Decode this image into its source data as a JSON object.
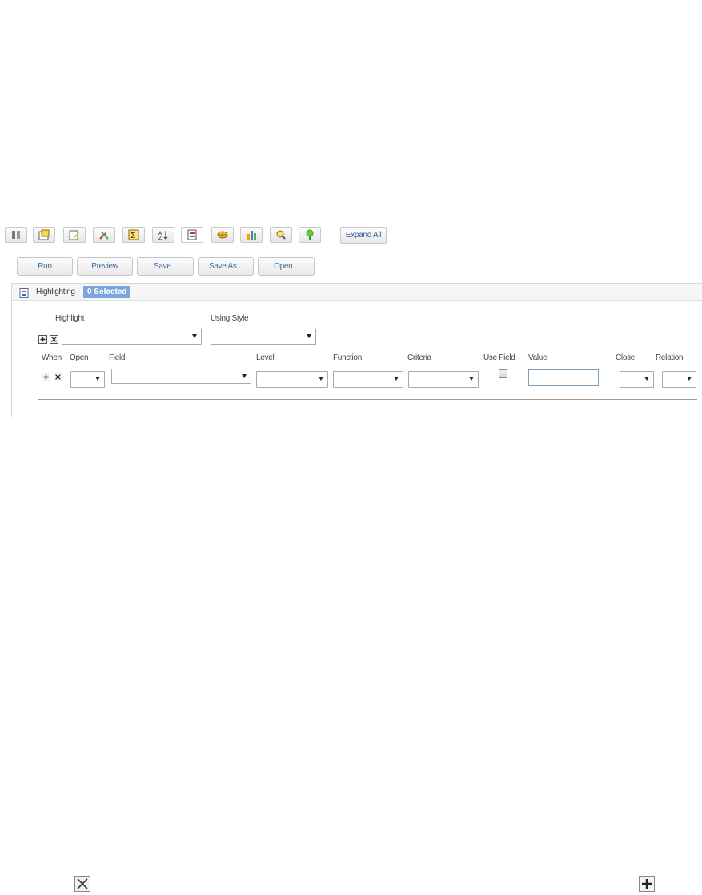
{
  "toolbar": {
    "icons": [
      "data-sources-icon",
      "report-properties-icon",
      "edit-layout-icon",
      "tools-icon",
      "sum-icon",
      "sort-icon",
      "highlighting-icon",
      "cross-tab-icon",
      "chart-icon",
      "map-pin-icon",
      "location-icon"
    ],
    "expand_all_label": "Expand All"
  },
  "actions": {
    "run": "Run",
    "preview": "Preview",
    "save": "Save...",
    "save_as": "Save As...",
    "open": "Open..."
  },
  "panel": {
    "title": "Highlighting",
    "selected_badge": "0 Selected",
    "highlight_label": "Highlight",
    "using_style_label": "Using Style",
    "columns": {
      "when": "When",
      "open": "Open",
      "field": "Field",
      "level": "Level",
      "function": "Function",
      "criteria": "Criteria",
      "use_field": "Use Field",
      "value": "Value",
      "close": "Close",
      "relation": "Relation"
    }
  },
  "colors": {
    "badge": "#7aa6dd",
    "link_text": "#3a6ea5"
  }
}
